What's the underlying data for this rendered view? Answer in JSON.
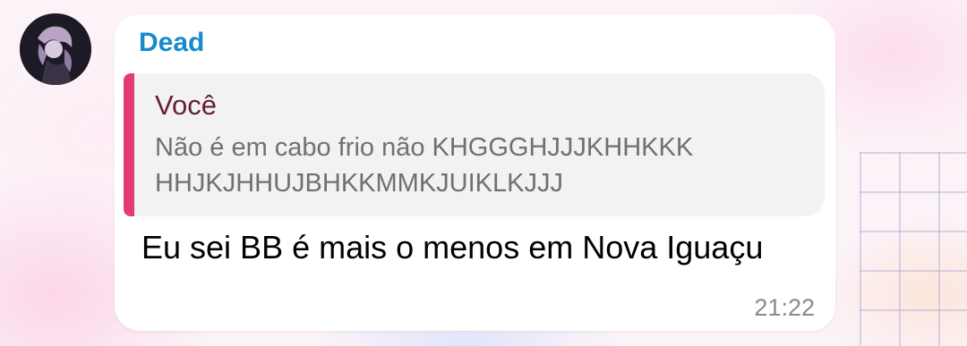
{
  "message": {
    "sender": "Dead",
    "reply": {
      "author": "Você",
      "text": "Não é em cabo frio não KHGGGHJJJKHHKKK HHJKJHHUJBHKKMMKJUIKLKJJJ"
    },
    "text": "Eu sei BB é mais o menos em Nova Iguaçu",
    "time": "21:22"
  },
  "colors": {
    "sender_name": "#168acd",
    "reply_bar": "#e43c72",
    "reply_author": "#63203c",
    "bubble": "#ffffff"
  }
}
